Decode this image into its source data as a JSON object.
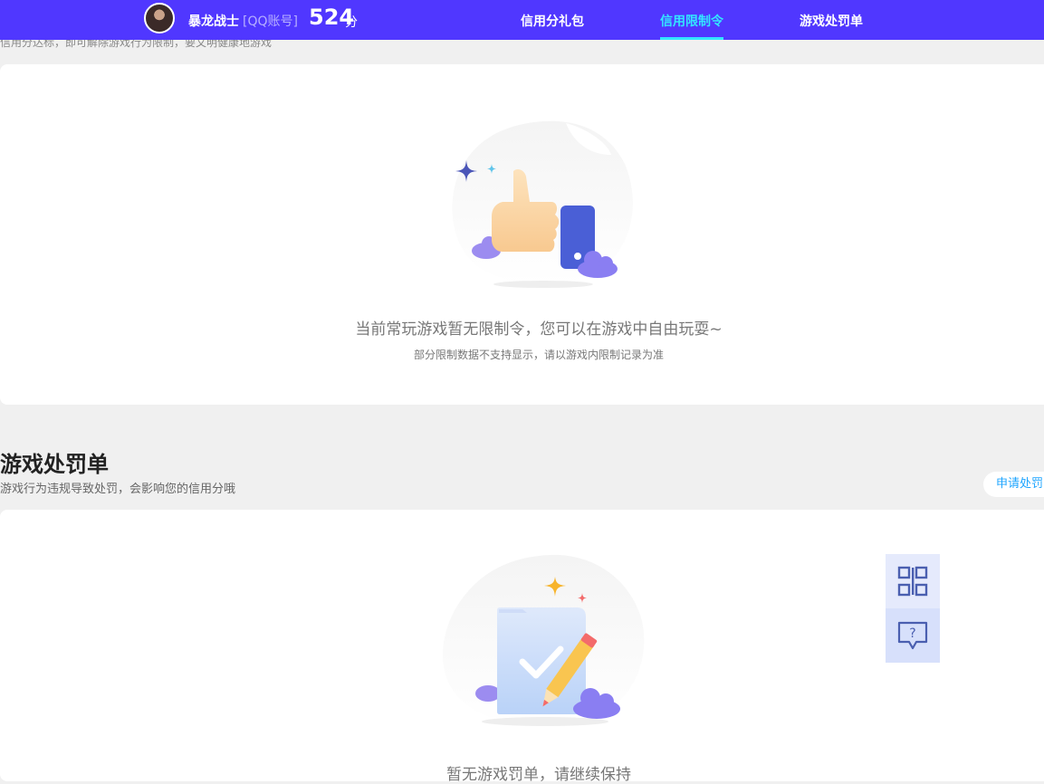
{
  "header": {
    "username": "暴龙战士",
    "account_type": "[QQ账号]",
    "score": "524",
    "score_unit": "分",
    "tabs": [
      {
        "label": "信用分礼包",
        "active": false
      },
      {
        "label": "信用限制令",
        "active": true
      },
      {
        "label": "游戏处罚单",
        "active": false
      }
    ]
  },
  "restriction_section": {
    "clipped_desc": "信用分达标，即可解除游戏行为限制，要文明健康地游戏",
    "empty_title": "当前常玩游戏暂无限制令，您可以在游戏中自由玩耍~",
    "empty_subtitle": "部分限制数据不支持显示，请以游戏内限制记录为准"
  },
  "penalty_section": {
    "title": "游戏处罚单",
    "description": "游戏行为违规导致处罚，会影响您的信用分哦",
    "apply_button": "申请处罚",
    "empty_title": "暂无游戏罚单，请继续保持"
  },
  "side_tools": [
    {
      "icon": "qr-code-icon"
    },
    {
      "icon": "help-chat-icon"
    }
  ],
  "colors": {
    "header_bg": "#5037ff",
    "active_tab": "#33e6ff",
    "link": "#1ea5ff"
  }
}
